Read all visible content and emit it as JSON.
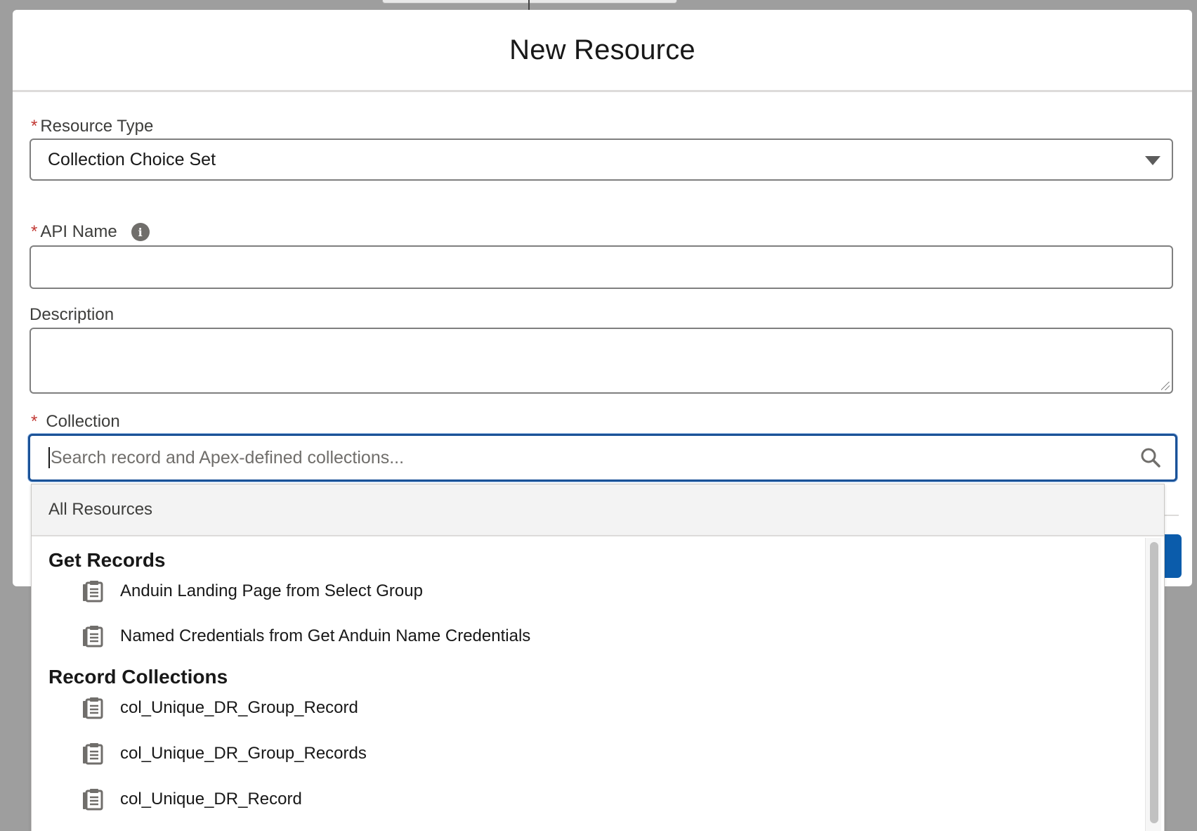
{
  "modal": {
    "title": "New Resource"
  },
  "form": {
    "required_marker": "*",
    "resource_type": {
      "label": "Resource Type",
      "value": "Collection Choice Set"
    },
    "api_name": {
      "label": "API Name",
      "value": "",
      "info_icon": "info-icon"
    },
    "description": {
      "label": "Description",
      "value": ""
    },
    "collection": {
      "label": "Collection",
      "placeholder": "Search record and Apex-defined collections..."
    }
  },
  "dropdown": {
    "header": "All Resources",
    "groups": [
      {
        "heading": "Get Records",
        "items": [
          {
            "label": "Anduin Landing Page from Select Group",
            "icon": "record-collection-icon"
          },
          {
            "label": "Named Credentials from Get Anduin Name Credentials",
            "icon": "record-collection-icon"
          }
        ]
      },
      {
        "heading": "Record Collections",
        "items": [
          {
            "label": "col_Unique_DR_Group_Record",
            "icon": "record-collection-icon"
          },
          {
            "label": "col_Unique_DR_Group_Records",
            "icon": "record-collection-icon"
          },
          {
            "label": "col_Unique_DR_Record",
            "icon": "record-collection-icon"
          }
        ]
      }
    ]
  },
  "colors": {
    "focus_border": "#1b5297",
    "required": "#c23934",
    "brand_button": "#0b5cab"
  }
}
